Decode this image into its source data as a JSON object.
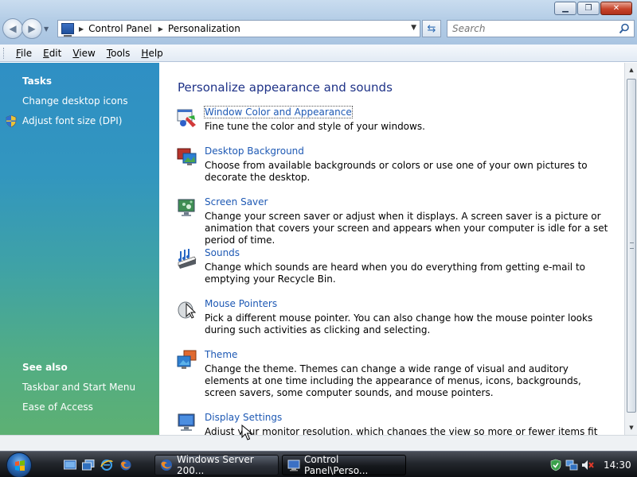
{
  "window": {
    "address": {
      "crumbs": [
        "Control Panel",
        "Personalization"
      ]
    },
    "search_placeholder": "Search",
    "menu": [
      {
        "label": "File",
        "accel": "F",
        "rest": "ile"
      },
      {
        "label": "Edit",
        "accel": "E",
        "rest": "dit"
      },
      {
        "label": "View",
        "accel": "V",
        "rest": "iew"
      },
      {
        "label": "Tools",
        "accel": "T",
        "rest": "ools"
      },
      {
        "label": "Help",
        "accel": "H",
        "rest": "elp"
      }
    ]
  },
  "sidebar": {
    "tasks_title": "Tasks",
    "tasks": [
      "Change desktop icons",
      "Adjust font size (DPI)"
    ],
    "seealso_title": "See also",
    "seealso": [
      "Taskbar and Start Menu",
      "Ease of Access"
    ]
  },
  "content": {
    "heading": "Personalize appearance and sounds",
    "items": [
      {
        "title": "Window Color and Appearance",
        "desc": "Fine tune the color and style of your windows.",
        "icon": "window-color-icon"
      },
      {
        "title": "Desktop Background",
        "desc": "Choose from available backgrounds or colors or use one of your own pictures to decorate the desktop.",
        "icon": "desktop-background-icon"
      },
      {
        "title": "Screen Saver",
        "desc": "Change your screen saver or adjust when it displays. A screen saver is a picture or animation that covers your screen and appears when your computer is idle for a set period of time.",
        "icon": "screen-saver-icon"
      },
      {
        "title": "Sounds",
        "desc": "Change which sounds are heard when you do everything from getting e-mail to emptying your Recycle Bin.",
        "icon": "sounds-icon"
      },
      {
        "title": "Mouse Pointers",
        "desc": "Pick a different mouse pointer. You can also change how the mouse pointer looks during such activities as clicking and selecting.",
        "icon": "mouse-pointers-icon"
      },
      {
        "title": "Theme",
        "desc": "Change the theme. Themes can change a wide range of visual and auditory elements at one time including the appearance of menus, icons, backgrounds, screen savers, some computer sounds, and mouse pointers.",
        "icon": "theme-icon"
      },
      {
        "title": "Display Settings",
        "desc": "Adjust your monitor resolution, which changes the view so more or fewer items fit on the screen.",
        "icon": "display-settings-icon"
      }
    ]
  },
  "taskbar": {
    "buttons": [
      "Windows Server 200...",
      "Control Panel\\Perso..."
    ],
    "clock": "14:30"
  },
  "colors": {
    "link": "#1e59b4",
    "heading": "#1e3287",
    "sidebar_top": "#2f8fc4",
    "sidebar_bottom": "#5db073"
  }
}
